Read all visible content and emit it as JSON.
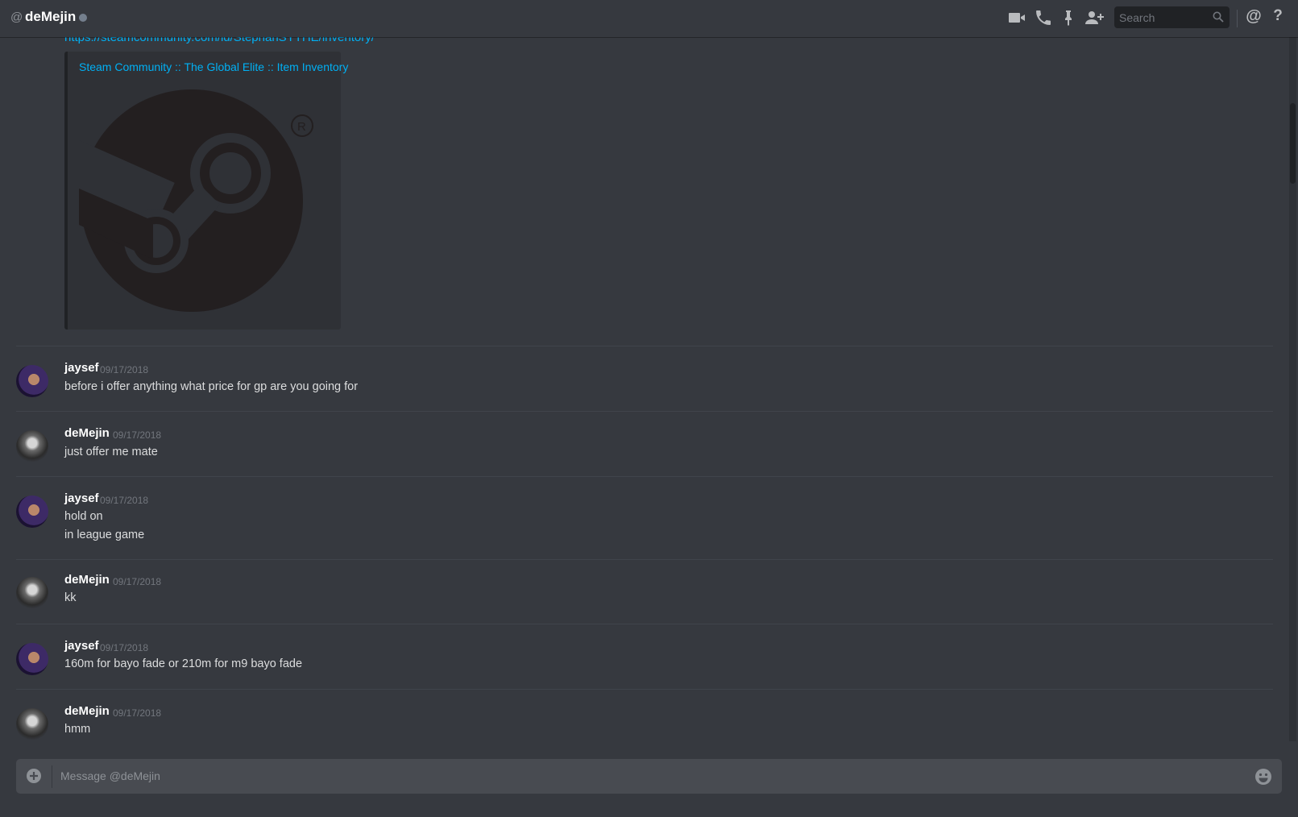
{
  "header": {
    "at_symbol": "@",
    "title": "deMejin",
    "status": "offline",
    "icons": [
      "video-call-icon",
      "voice-call-icon",
      "pin-icon",
      "add-friend-icon",
      "mention-icon",
      "help-icon"
    ],
    "search_placeholder": "Search",
    "mention_label": "@",
    "help_label": "?"
  },
  "embed": {
    "link": "https://steamcommunity.com/id/StephanSYTHE/inventory/",
    "title": "Steam Community :: The Global Elite :: Item Inventory",
    "image": "steam-logo"
  },
  "messages": [
    {
      "author": "jaysef",
      "timestamp": "09/17/2018",
      "lines": [
        "before i offer anything what price for gp are you going for"
      ]
    },
    {
      "author": "deMejin",
      "timestamp": "09/17/2018",
      "lines": [
        "just offer me mate"
      ]
    },
    {
      "author": "jaysef",
      "timestamp": "09/17/2018",
      "lines": [
        "hold on",
        "in league game"
      ]
    },
    {
      "author": "deMejin",
      "timestamp": "09/17/2018",
      "lines": [
        "kk"
      ]
    },
    {
      "author": "jaysef",
      "timestamp": "09/17/2018",
      "lines": [
        "160m for bayo fade or 210m for m9 bayo fade"
      ]
    },
    {
      "author": "deMejin",
      "timestamp": "09/17/2018",
      "lines": [
        "hmm"
      ]
    }
  ],
  "composer": {
    "placeholder": "Message @deMejin"
  },
  "colors": {
    "background": "#36393f",
    "link": "#00b0f4",
    "status_offline": "#747f8d"
  }
}
